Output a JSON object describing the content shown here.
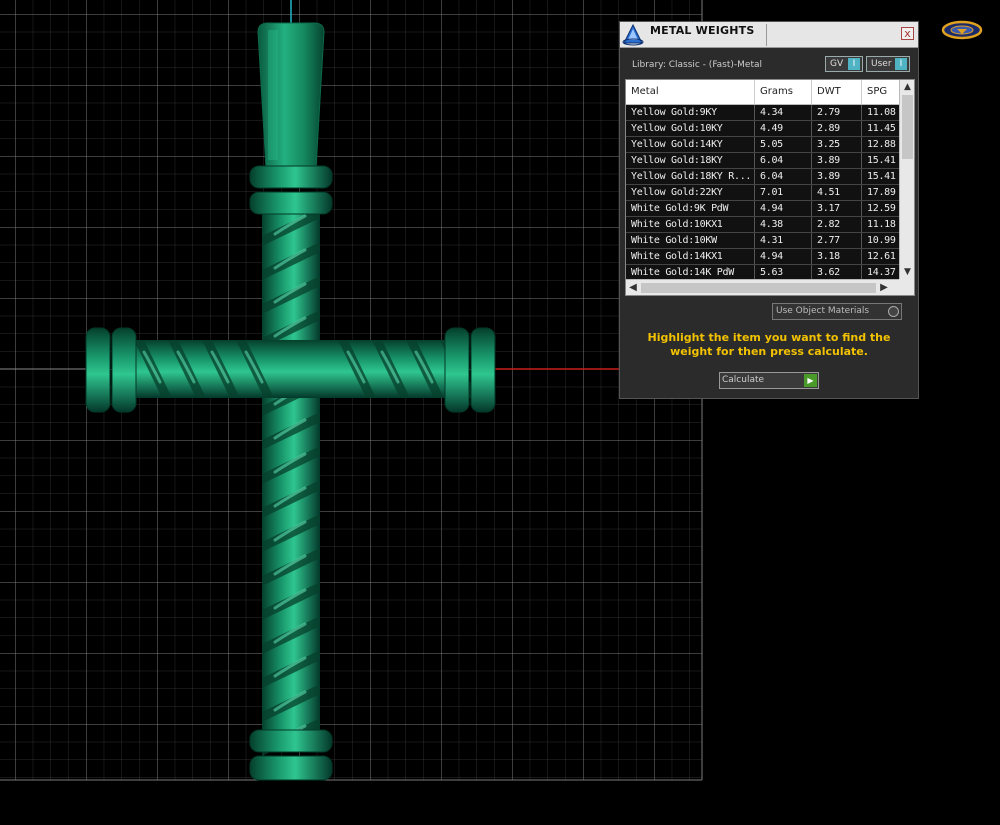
{
  "panel": {
    "title": "METAL WEIGHTS",
    "close_glyph": "x",
    "library_label": "Library: Classic - (Fast)-Metal",
    "toggle_gv": "GV",
    "toggle_user": "User",
    "toggle_knob": "I",
    "columns": [
      "Metal",
      "Grams",
      "DWT",
      "SPG"
    ],
    "rows": [
      [
        "Yellow Gold:9KY",
        "4.34",
        "2.79",
        "11.08"
      ],
      [
        "Yellow Gold:10KY",
        "4.49",
        "2.89",
        "11.45"
      ],
      [
        "Yellow Gold:14KY",
        "5.05",
        "3.25",
        "12.88"
      ],
      [
        "Yellow Gold:18KY",
        "6.04",
        "3.89",
        "15.41"
      ],
      [
        "Yellow Gold:18KY R...",
        "6.04",
        "3.89",
        "15.41"
      ],
      [
        "Yellow Gold:22KY",
        "7.01",
        "4.51",
        "17.89"
      ],
      [
        "White Gold:9K PdW",
        "4.94",
        "3.17",
        "12.59"
      ],
      [
        "White Gold:10KX1",
        "4.38",
        "2.82",
        "11.18"
      ],
      [
        "White Gold:10KW",
        "4.31",
        "2.77",
        "10.99"
      ],
      [
        "White Gold:14KX1",
        "4.94",
        "3.18",
        "12.61"
      ],
      [
        "White Gold:14K PdW",
        "5.63",
        "3.62",
        "14.37"
      ]
    ],
    "use_object_materials": "Use Object Materials",
    "instruction": "Highlight the item you want to find the weight for then press calculate.",
    "calculate_label": "Calculate",
    "calculate_glyph": "▶"
  },
  "icons": {
    "app_logo": "matrix-logo-icon",
    "corner_logo": "gemvision-logo-icon"
  },
  "colors": {
    "background": "#000000",
    "model": "#0f7a55",
    "grid": "#6a6a6a",
    "x_axis": "#c8201a",
    "y_axis": "#20b8c8",
    "instruction": "#f2c200",
    "toggle_knob": "#4fb3c4"
  }
}
